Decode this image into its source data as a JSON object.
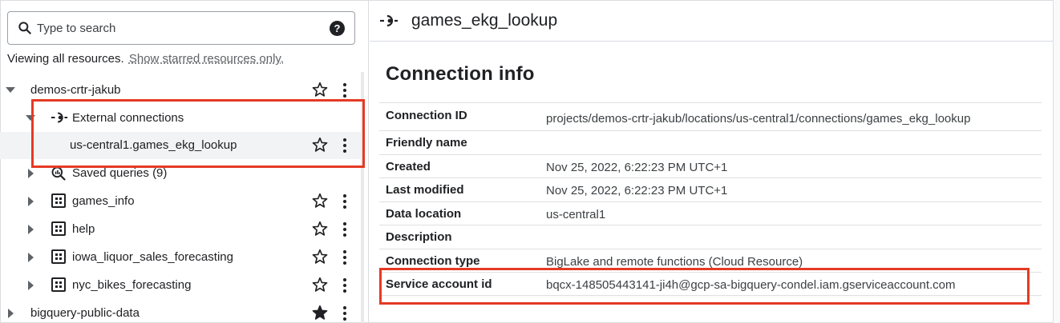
{
  "search": {
    "placeholder": "Type to search"
  },
  "viewing": {
    "text": "Viewing all resources.",
    "link": "Show starred resources only."
  },
  "tree": {
    "project": "demos-crtr-jakub",
    "external_connections": "External connections",
    "connection": "us-central1.games_ekg_lookup",
    "saved_queries": "Saved queries (9)",
    "datasets": [
      "games_info",
      "help",
      "iowa_liquor_sales_forecasting",
      "nyc_bikes_forecasting"
    ],
    "public_project": "bigquery-public-data"
  },
  "detail": {
    "title": "games_ekg_lookup",
    "section_title": "Connection info",
    "rows": [
      {
        "key": "Connection ID",
        "value": "projects/demos-crtr-jakub/locations/us-central1/connections/games_ekg_lookup"
      },
      {
        "key": "Friendly name",
        "value": ""
      },
      {
        "key": "Created",
        "value": "Nov 25, 2022, 6:22:23 PM UTC+1"
      },
      {
        "key": "Last modified",
        "value": "Nov 25, 2022, 6:22:23 PM UTC+1"
      },
      {
        "key": "Data location",
        "value": "us-central1"
      },
      {
        "key": "Description",
        "value": ""
      },
      {
        "key": "Connection type",
        "value": "BigLake and remote functions (Cloud Resource)"
      },
      {
        "key": "Service account id",
        "value": "bqcx-148505443141-ji4h@gcp-sa-bigquery-condel.iam.gserviceaccount.com"
      }
    ]
  },
  "colors": {
    "highlight": "#e53a24",
    "selected_row": "#f1f3f4",
    "text": "#202124"
  }
}
